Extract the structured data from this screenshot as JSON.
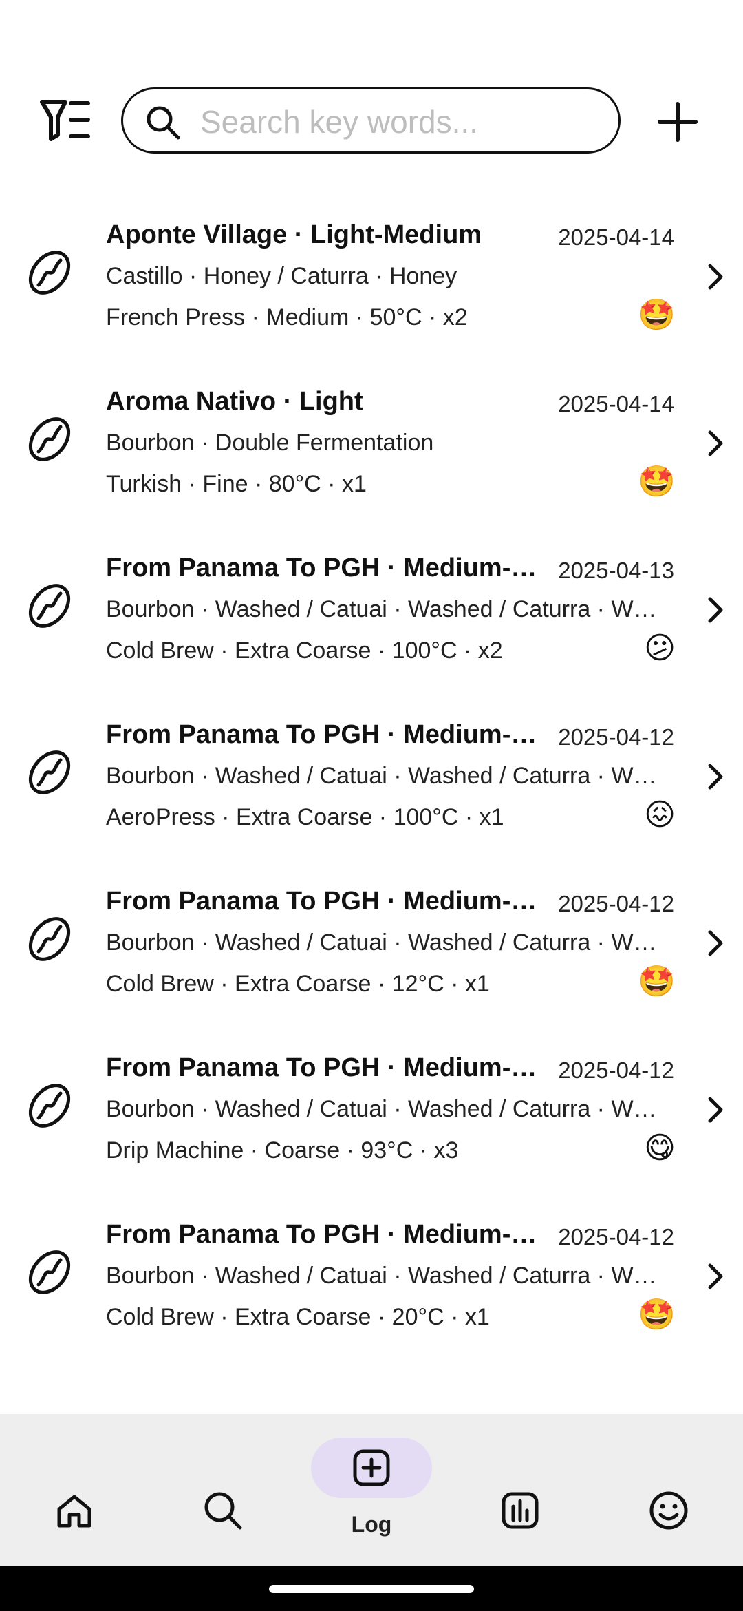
{
  "search": {
    "placeholder": "Search key words..."
  },
  "entries": [
    {
      "title": "Aponte Village · Light-Medium",
      "date": "2025-04-14",
      "origin": "Castillo · Honey / Caturra · Honey",
      "brew": "French Press · Medium · 50°C · x2",
      "rating": "🤩"
    },
    {
      "title": "Aroma Nativo · Light",
      "date": "2025-04-14",
      "origin": "Bourbon · Double Fermentation",
      "brew": "Turkish · Fine · 80°C · x1",
      "rating": "🤩"
    },
    {
      "title": "From Panama To PGH · Medium-…",
      "date": "2025-04-13",
      "origin": "Bourbon · Washed / Catuai · Washed / Caturra · W…",
      "brew": "Cold Brew · Extra Coarse · 100°C · x2",
      "rating": "😕"
    },
    {
      "title": "From Panama To PGH · Medium-…",
      "date": "2025-04-12",
      "origin": "Bourbon · Washed / Catuai · Washed / Caturra · W…",
      "brew": "AeroPress · Extra Coarse · 100°C · x1",
      "rating": "😖"
    },
    {
      "title": "From Panama To PGH · Medium-…",
      "date": "2025-04-12",
      "origin": "Bourbon · Washed / Catuai · Washed / Caturra · W…",
      "brew": "Cold Brew · Extra Coarse · 12°C · x1",
      "rating": "🤩"
    },
    {
      "title": "From Panama To PGH · Medium-…",
      "date": "2025-04-12",
      "origin": "Bourbon · Washed / Catuai · Washed / Caturra · W…",
      "brew": "Drip Machine · Coarse · 93°C · x3",
      "rating": "😋"
    },
    {
      "title": "From Panama To PGH · Medium-…",
      "date": "2025-04-12",
      "origin": "Bourbon · Washed / Catuai · Washed / Caturra · W…",
      "brew": "Cold Brew · Extra Coarse · 20°C · x1",
      "rating": "🤩"
    }
  ],
  "nav": {
    "items": [
      {
        "icon": "home-icon"
      },
      {
        "icon": "search-icon"
      },
      {
        "icon": "add-log-icon",
        "label": "Log",
        "active": true
      },
      {
        "icon": "stats-icon"
      },
      {
        "icon": "profile-smiley-icon"
      }
    ],
    "active_pill_color": "#e4dcf5",
    "background_color": "#eeeeee"
  }
}
